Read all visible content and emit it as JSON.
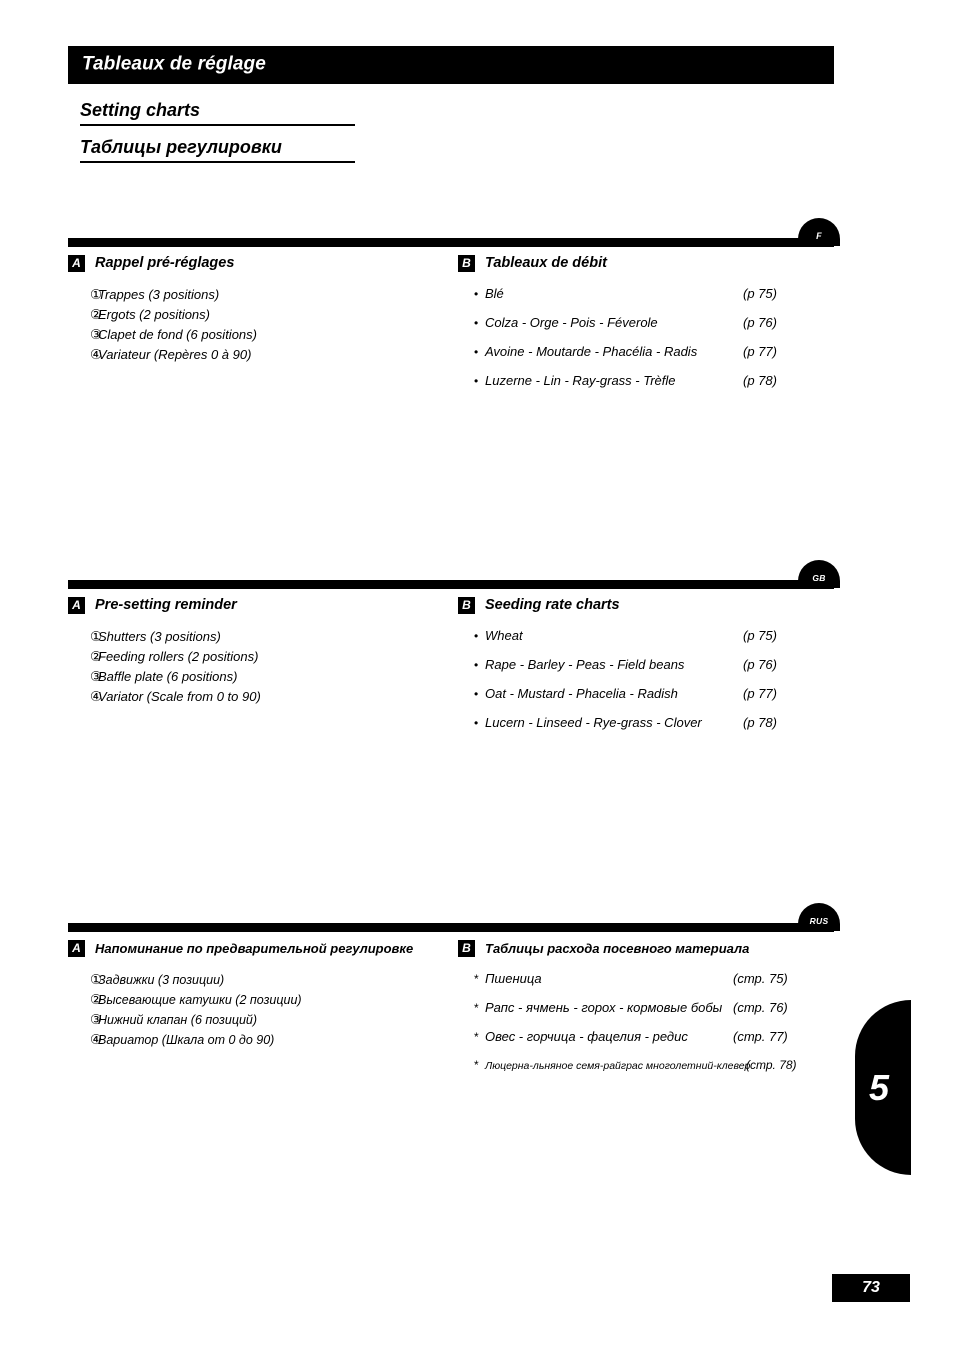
{
  "header": {
    "title_fr": "Tableaux de réglage",
    "title_en": "Setting charts",
    "title_ru": "Таблицы регулировки"
  },
  "sections": [
    {
      "lang_badge": "F",
      "left": {
        "marker": "A",
        "heading": "Rappel pré-réglages",
        "items": [
          {
            "num": "①",
            "text": "Trappes  (3 positions)"
          },
          {
            "num": "②",
            "text": "Ergots  (2 positions)"
          },
          {
            "num": "③",
            "text": "Clapet de fond  (6 positions)"
          },
          {
            "num": "④",
            "text": "Variateur  (Repères  0  à  90)"
          }
        ]
      },
      "right": {
        "marker": "B",
        "heading": "Tableaux de débit",
        "bullet": "•",
        "items": [
          {
            "label": "Blé",
            "page": "(p 75)"
          },
          {
            "label": "Colza - Orge - Pois - Féverole",
            "page": "(p 76)"
          },
          {
            "label": "Avoine - Moutarde - Phacélia - Radis",
            "page": "(p 77)"
          },
          {
            "label": "Luzerne - Lin - Ray-grass - Trèfle",
            "page": "(p 78)"
          }
        ]
      }
    },
    {
      "lang_badge": "GB",
      "left": {
        "marker": "A",
        "heading": "Pre-setting reminder",
        "items": [
          {
            "num": "①",
            "text": "Shutters (3 positions)"
          },
          {
            "num": "②",
            "text": "Feeding rollers (2 positions)"
          },
          {
            "num": "③",
            "text": "Baffle plate (6 positions)"
          },
          {
            "num": "④",
            "text": "Variator (Scale from 0 to 90)"
          }
        ]
      },
      "right": {
        "marker": "B",
        "heading": "Seeding rate charts",
        "bullet": "•",
        "items": [
          {
            "label": "Wheat",
            "page": "(p 75)"
          },
          {
            "label": "Rape - Barley - Peas - Field beans",
            "page": "(p 76)"
          },
          {
            "label": "Oat - Mustard - Phacelia - Radish",
            "page": "(p 77)"
          },
          {
            "label": "Lucern - Linseed - Rye-grass - Clover",
            "page": "(p 78)"
          }
        ]
      }
    },
    {
      "lang_badge": "RUS",
      "left": {
        "marker": "A",
        "heading": "Напоминание по предварительной регулировке",
        "items": [
          {
            "num": "①",
            "text": "Задвижки (3 позиции)"
          },
          {
            "num": "②",
            "text": "Высевающие катушки (2 позиции)"
          },
          {
            "num": "③",
            "text": "Нижний клапан (6 позиций)"
          },
          {
            "num": "④",
            "text": "Вариатор (Шкала от 0 до 90)"
          }
        ]
      },
      "right": {
        "marker": "B",
        "heading": "Таблицы расхода посевного материала",
        "bullet": "*",
        "items": [
          {
            "label": "Пшеница",
            "page": "(стр. 75)"
          },
          {
            "label": "Рапс - ячмень - горох - кормовые бобы",
            "page": "(стр. 76)"
          },
          {
            "label": "Овес - горчица - фацелия - редис",
            "page": "(стр. 77)"
          },
          {
            "label": "Люцерна-льняное семя-райграс многолетний-клевер",
            "page": "(стр. 78)",
            "small": true
          }
        ]
      }
    }
  ],
  "chapter_tab": {
    "number": "5"
  },
  "footer": {
    "page_number": "73"
  },
  "colors": {
    "ink": "#000000",
    "paper": "#ffffff"
  }
}
